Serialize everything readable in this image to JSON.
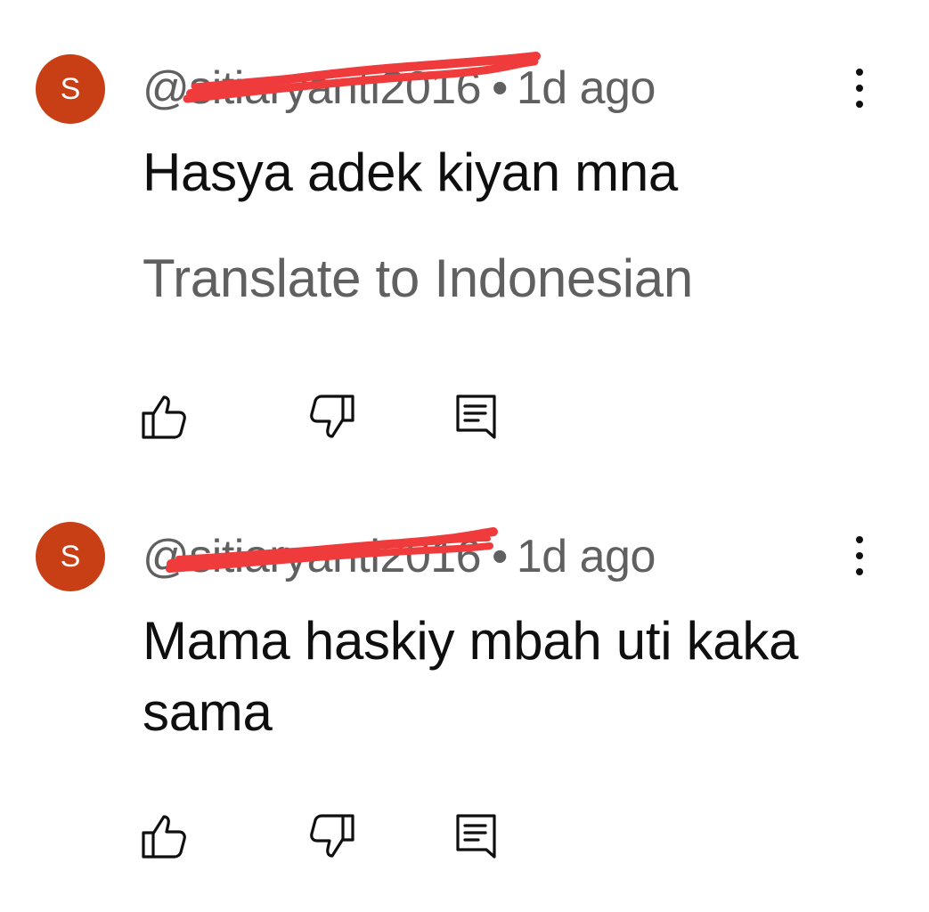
{
  "colors": {
    "avatar_background": "#c83f16",
    "redaction_stroke": "#ef3b3b"
  },
  "comments": [
    {
      "avatar_letter": "S",
      "handle": "@sitiaryanti2016",
      "separator": "•",
      "time": "1d ago",
      "text": "Hasya adek kiyan mna",
      "translate_label": "Translate to Indonesian",
      "icons": {
        "more": "more-vertical-icon",
        "like": "thumb-up-icon",
        "dislike": "thumb-down-icon",
        "reply": "reply-comment-icon"
      }
    },
    {
      "avatar_letter": "S",
      "handle": "@sitiaryanti2016",
      "separator": "•",
      "time": "1d ago",
      "text": "Mama haskiy mbah uti kaka sama",
      "icons": {
        "more": "more-vertical-icon",
        "like": "thumb-up-icon",
        "dislike": "thumb-down-icon",
        "reply": "reply-comment-icon"
      }
    }
  ]
}
